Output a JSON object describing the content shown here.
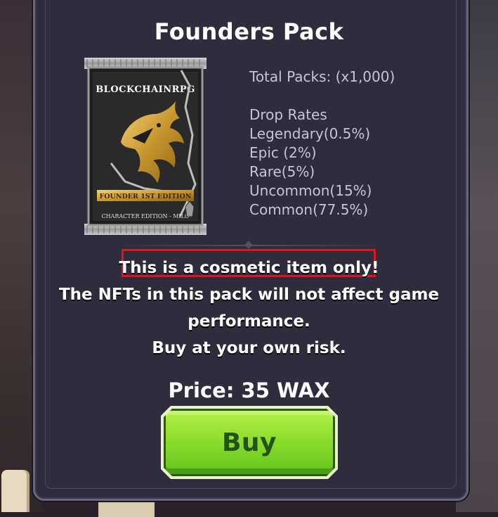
{
  "title": "Founders Pack",
  "pack_art": {
    "brand_text": "BLOCKCHAINRPG",
    "edition_ribbon": "FOUNDER 1ST EDITION",
    "footer_text": "CHARACTER EDITION - MILO"
  },
  "stats": {
    "total_packs": "Total Packs: (x1,000)",
    "drop_rates_heading": "Drop Rates",
    "rates": [
      "Legendary(0.5%)",
      "Epic (2%)",
      "Rare(5%)",
      "Uncommon(15%)",
      "Common(77.5%)"
    ]
  },
  "notice": {
    "highlighted": "This is a cosmetic item only!",
    "line2": "The NFTs in this pack will not affect game",
    "line3": "performance.",
    "line4": "Buy at your own risk."
  },
  "price": "Price: 35 WAX",
  "buy_label": "Buy",
  "colors": {
    "panel_bg": "#2f2c3d",
    "highlight_border": "#e0141c",
    "buy_green": "#8ede2c",
    "buy_text": "#23521e",
    "pack_gold": "#d4a63a"
  }
}
